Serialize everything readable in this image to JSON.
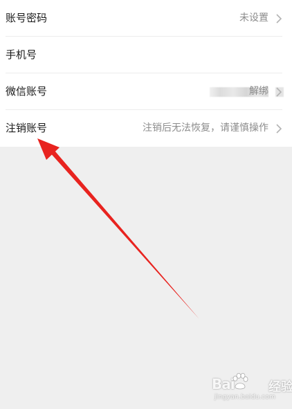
{
  "settings": {
    "rows": [
      {
        "label": "账号密码",
        "value": "未设置"
      },
      {
        "label": "手机号",
        "value": ""
      },
      {
        "label": "微信账号",
        "value": "解绑"
      },
      {
        "label": "注销账号",
        "value": "注销后无法恢复，请谨慎操作"
      }
    ]
  },
  "annotation": {
    "arrow_color": "#e8231f",
    "points_to": "注销账号"
  },
  "watermark": {
    "brand_part1": "Bai",
    "brand_part2": "经验",
    "brand_du": "du",
    "url": "jingyan.baidu.com"
  },
  "icons": {
    "chevron": "chevron-right-icon"
  }
}
